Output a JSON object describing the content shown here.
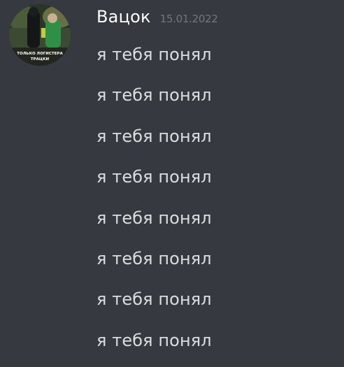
{
  "message": {
    "author": "Вацок",
    "timestamp": "15.01.2022",
    "avatar": {
      "icon": "user-avatar-icon",
      "caption_line1": "ТОЛЬКО ЛОГИСТЕРА",
      "caption_line2": "ТРАЦКИ"
    },
    "lines": [
      "я тебя понял",
      "я тебя понял",
      "я тебя понял",
      "я тебя понял",
      "я тебя понял",
      "я тебя понял",
      "я тебя понял",
      "я тебя понял"
    ]
  },
  "colors": {
    "background": "#36393f",
    "username": "#ffffff",
    "timestamp": "#72767d",
    "message_text": "#dcddde"
  }
}
